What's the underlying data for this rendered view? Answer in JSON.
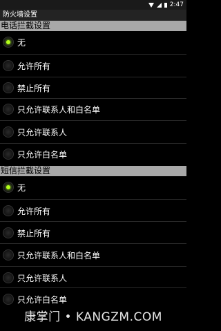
{
  "status_bar": {
    "time": "2:47"
  },
  "app": {
    "title": "防火墙设置"
  },
  "call_section": {
    "header": "电话拦截设置",
    "options": [
      {
        "label": "无",
        "checked": true
      },
      {
        "label": "允许所有",
        "checked": false
      },
      {
        "label": "禁止所有",
        "checked": false
      },
      {
        "label": "只允许联系人和白名单",
        "checked": false
      },
      {
        "label": "只允许联系人",
        "checked": false
      },
      {
        "label": "只允许白名单",
        "checked": false
      }
    ]
  },
  "sms_section": {
    "header": "短信拦截设置",
    "options": [
      {
        "label": "无",
        "checked": true
      },
      {
        "label": "允许所有",
        "checked": false
      },
      {
        "label": "禁止所有",
        "checked": false
      },
      {
        "label": "只允许联系人和白名单",
        "checked": false
      },
      {
        "label": "只允许联系人",
        "checked": false
      },
      {
        "label": "只允许白名单",
        "checked": false
      }
    ]
  },
  "watermark": "康掌门 • KANGZM.COM",
  "colors": {
    "accent": "#b4ff1a",
    "section_header_bg": "#a8a8a8",
    "background": "#000000"
  }
}
